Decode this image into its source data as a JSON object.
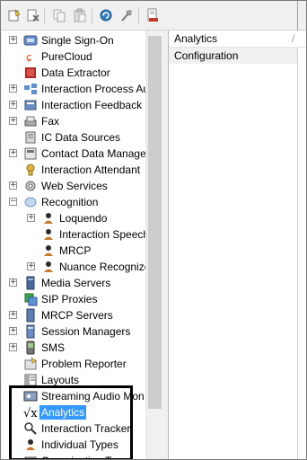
{
  "toolbar": {
    "buttons": [
      {
        "name": "new-item-icon"
      },
      {
        "name": "delete-icon"
      },
      {
        "name": "copy-icon"
      },
      {
        "name": "paste-icon"
      },
      {
        "name": "refresh-icon"
      },
      {
        "name": "properties-icon"
      },
      {
        "name": "export-icon"
      }
    ]
  },
  "tree": {
    "items": [
      {
        "label": "Single Sign-On",
        "expander": "+",
        "icon": "single-sign-on-icon"
      },
      {
        "label": "PureCloud",
        "expander": "",
        "icon": "purecloud-icon"
      },
      {
        "label": "Data Extractor",
        "expander": "",
        "icon": "data-extractor-icon"
      },
      {
        "label": "Interaction Process Au",
        "expander": "+",
        "icon": "process-icon"
      },
      {
        "label": "Interaction Feedback",
        "expander": "+",
        "icon": "feedback-icon"
      },
      {
        "label": "Fax",
        "expander": "+",
        "icon": "fax-icon"
      },
      {
        "label": "IC Data Sources",
        "expander": "",
        "icon": "data-sources-icon"
      },
      {
        "label": "Contact Data Manage",
        "expander": "+",
        "icon": "contact-data-icon"
      },
      {
        "label": "Interaction Attendant",
        "expander": "",
        "icon": "attendant-icon"
      },
      {
        "label": "Web Services",
        "expander": "+",
        "icon": "web-services-icon"
      },
      {
        "label": "Recognition",
        "expander": "-",
        "icon": "recognition-icon"
      },
      {
        "label": "Loquendo",
        "expander": "+",
        "icon": "user-icon",
        "child": true
      },
      {
        "label": "Interaction Speech",
        "expander": "",
        "icon": "user-icon",
        "child": true
      },
      {
        "label": "MRCP",
        "expander": "",
        "icon": "user-icon",
        "child": true
      },
      {
        "label": "Nuance Recognize",
        "expander": "+",
        "icon": "user-icon",
        "child": true
      },
      {
        "label": "Media Servers",
        "expander": "+",
        "icon": "media-servers-icon"
      },
      {
        "label": "SIP Proxies",
        "expander": "",
        "icon": "sip-proxies-icon"
      },
      {
        "label": "MRCP Servers",
        "expander": "+",
        "icon": "mrcp-servers-icon"
      },
      {
        "label": "Session Managers",
        "expander": "+",
        "icon": "session-managers-icon"
      },
      {
        "label": "SMS",
        "expander": "+",
        "icon": "sms-icon"
      },
      {
        "label": "Problem Reporter",
        "expander": "",
        "icon": "problem-reporter-icon"
      },
      {
        "label": "Layouts",
        "expander": "",
        "icon": "layouts-icon"
      },
      {
        "label": "Streaming Audio Mon",
        "expander": "",
        "icon": "streaming-audio-icon"
      },
      {
        "label": "Analytics",
        "expander": "",
        "icon": "analytics-sqrt-icon",
        "selected": true
      },
      {
        "label": "Interaction Tracker",
        "expander": "",
        "icon": "tracker-icon"
      },
      {
        "label": "Individual Types",
        "expander": "",
        "icon": "individual-types-icon"
      },
      {
        "label": "Organization Types",
        "expander": "",
        "icon": "organization-types-icon"
      }
    ]
  },
  "right": {
    "header_label": "Analytics",
    "header_divider": "/",
    "rows": [
      {
        "label": "Configuration"
      }
    ]
  },
  "colors": {
    "selection": "#3399ff",
    "row_bg": "#f0f0f0"
  }
}
